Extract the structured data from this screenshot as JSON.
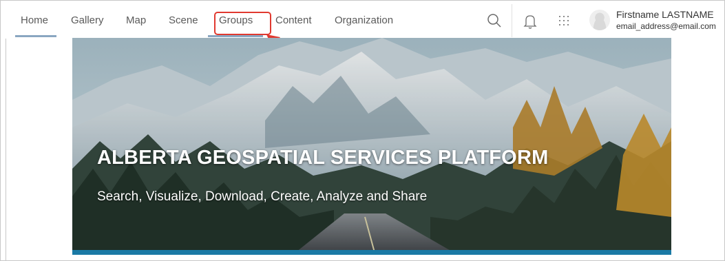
{
  "nav": {
    "items": [
      {
        "label": "Home"
      },
      {
        "label": "Gallery"
      },
      {
        "label": "Map"
      },
      {
        "label": "Scene"
      },
      {
        "label": "Groups"
      },
      {
        "label": "Content"
      },
      {
        "label": "Organization"
      }
    ],
    "active_item": "Home",
    "highlighted_item": "Groups"
  },
  "header_icons": [
    "search-icon",
    "bell-icon",
    "app-launcher-icon"
  ],
  "user": {
    "name": "Firstname LASTNAME",
    "email": "email_address@email.com"
  },
  "hero": {
    "title": "ALBERTA GEOSPATIAL SERVICES PLATFORM",
    "subtitle": "Search, Visualize, Download, Create, Analyze and Share"
  },
  "colors": {
    "accent_underline": "#8aa6c1",
    "highlight_box": "#e0392f",
    "hero_bar": "#1a7aa5"
  }
}
